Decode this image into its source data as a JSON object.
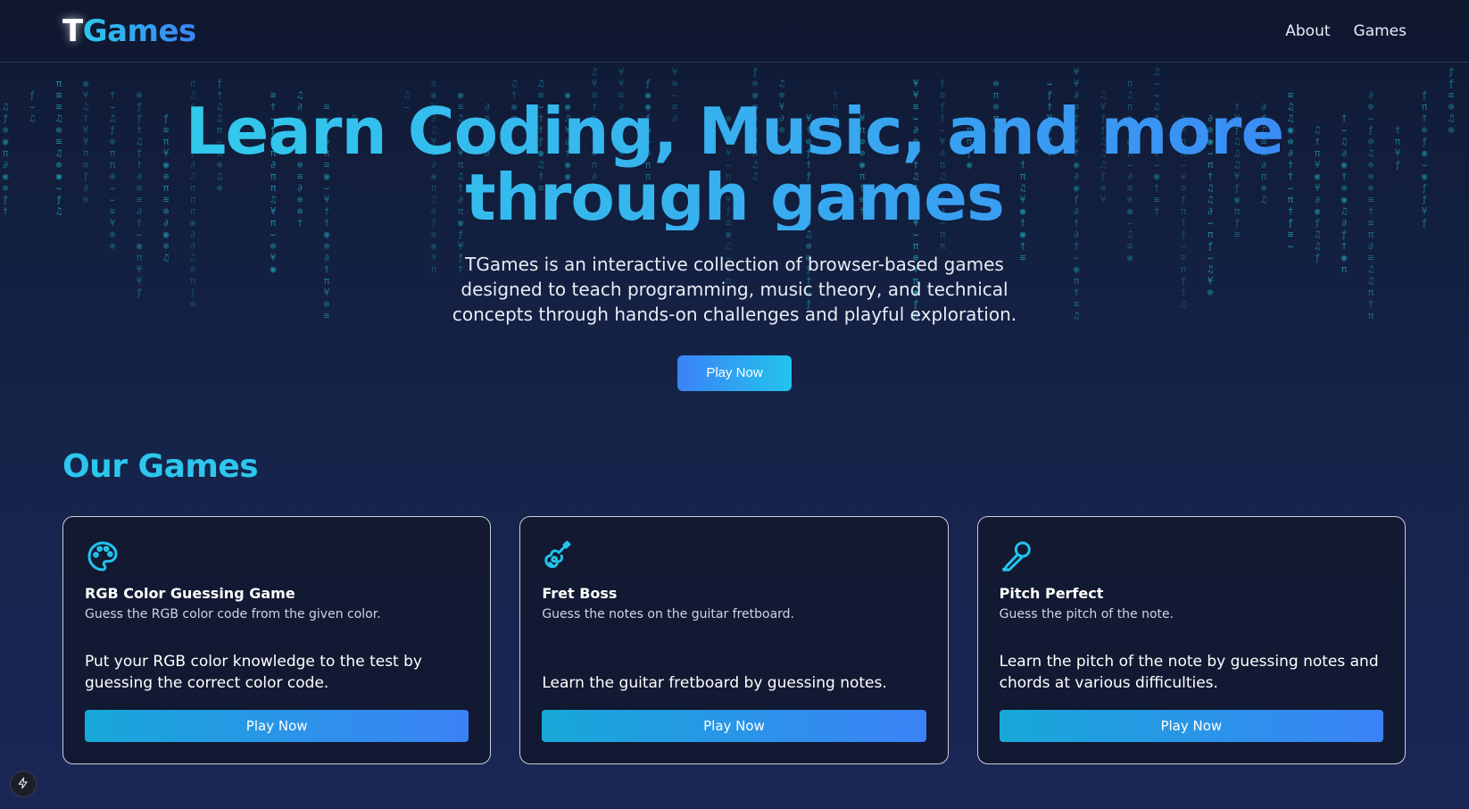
{
  "header": {
    "logo_t": "T",
    "logo_rest": "Games",
    "nav": [
      {
        "label": "About"
      },
      {
        "label": "Games"
      }
    ]
  },
  "hero": {
    "title": "Learn Coding, Music, and more through games",
    "description": "TGames is an interactive collection of browser-based games designed to teach programming, music theory, and technical concepts through hands-on challenges and playful exploration.",
    "cta_label": "Play Now"
  },
  "games_section": {
    "title": "Our Games",
    "cards": [
      {
        "icon": "palette-icon",
        "title": "RGB Color Guessing Game",
        "subtitle": "Guess the RGB color code from the given color.",
        "body": "Put your RGB color knowledge to the test by guessing the correct color code.",
        "button_label": "Play Now"
      },
      {
        "icon": "guitar-icon",
        "title": "Fret Boss",
        "subtitle": "Guess the notes on the guitar fretboard.",
        "body": "Learn the guitar fretboard by guessing notes.",
        "button_label": "Play Now"
      },
      {
        "icon": "microphone-icon",
        "title": "Pitch Perfect",
        "subtitle": "Guess the pitch of the note.",
        "body": "Learn the pitch of the note by guessing notes and chords at various difficulties.",
        "button_label": "Play Now"
      }
    ]
  },
  "colors": {
    "accent_cyan": "#2dc6ee",
    "accent_blue": "#3b82f6",
    "background": "#0f1a33"
  },
  "corner_badge_icon": "lightning-icon"
}
